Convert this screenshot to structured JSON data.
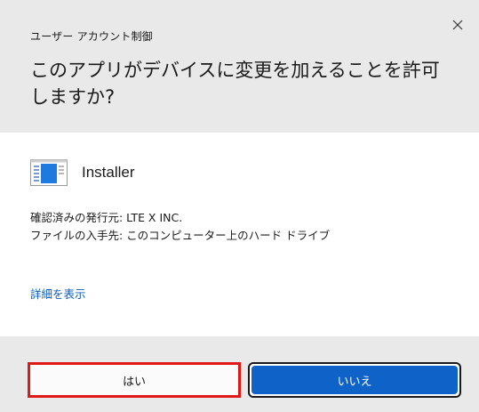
{
  "header": {
    "caption": "ユーザー アカウント制御",
    "question": "このアプリがデバイスに変更を加えることを許可しますか?",
    "close_icon": "close-icon"
  },
  "app": {
    "icon": "installer-app-icon",
    "name": "Installer"
  },
  "info": {
    "publisher_line": "確認済みの発行元: LTE X INC.",
    "source_line": "ファイルの入手先: このコンピューター上のハード ドライブ"
  },
  "details_link": "詳細を表示",
  "buttons": {
    "yes_label": "はい",
    "no_label": "いいえ"
  },
  "colors": {
    "header_bg": "#e9e9e9",
    "link": "#0a5cb8",
    "primary": "#0f62c8",
    "highlight": "#e01818"
  }
}
